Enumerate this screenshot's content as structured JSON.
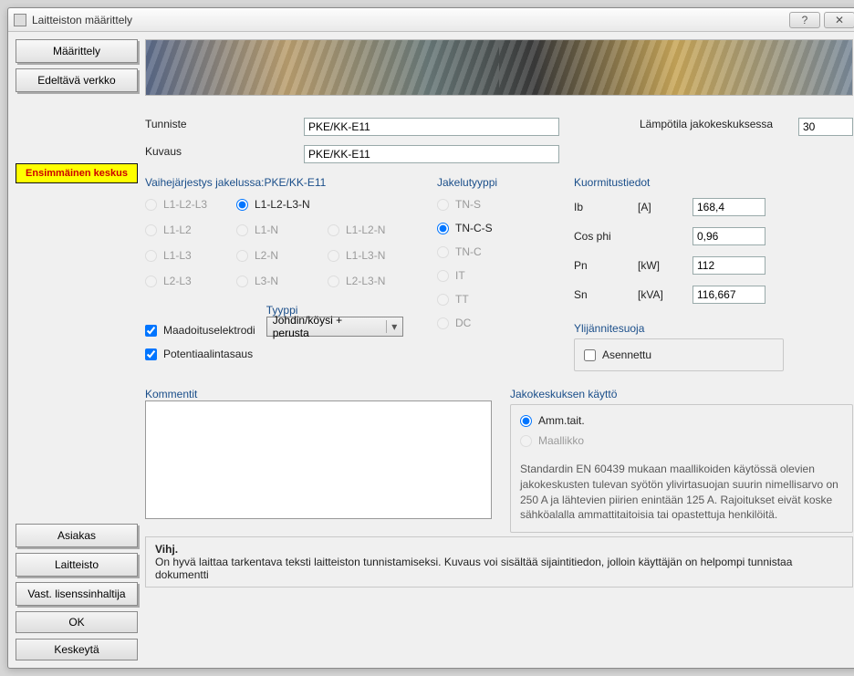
{
  "window": {
    "title": "Laitteiston määrittely"
  },
  "sidebar": {
    "define": "Määrittely",
    "prev_network": "Edeltävä verkko",
    "first_center": "Ensimmäinen keskus",
    "customer": "Asiakas",
    "hardware": "Laitteisto",
    "license_holder": "Vast. lisenssinhaltija",
    "ok": "OK",
    "cancel": "Keskeytä"
  },
  "labels": {
    "identifier": "Tunniste",
    "description": "Kuvaus",
    "phase_order_prefix": "Vaihejärjestys jakelussa:",
    "distribution_type": "Jakelutyyppi",
    "temp_in_dc": "Lämpötila jakokeskuksessa",
    "load_data": "Kuormitustiedot",
    "overvoltage": "Ylijännitesuoja",
    "type": "Tyyppi",
    "comments": "Kommentit",
    "usage": "Jakokeskuksen käyttö"
  },
  "values": {
    "identifier": "PKE/KK-E11",
    "description": "PKE/KK-E11",
    "phase_order_suffix": "PKE/KK-E11",
    "temp": "30",
    "ib": "168,4",
    "cosphi": "0,96",
    "pn": "112",
    "sn": "116,667",
    "combo": "Johdin/köysi + perusta"
  },
  "phase_options": {
    "r1": "L1-L2-L3",
    "r2": "L1-L2-L3-N",
    "r3": "L1-L2",
    "r4": "L1-N",
    "r5": "L1-L2-N",
    "r6": "L1-L3",
    "r7": "L2-N",
    "r8": "L1-L3-N",
    "r9": "L2-L3",
    "r10": "L3-N",
    "r11": "L2-L3-N"
  },
  "dist_options": {
    "tns": "TN-S",
    "tncs": "TN-C-S",
    "tnc": "TN-C",
    "it": "IT",
    "tt": "TT",
    "dc": "DC"
  },
  "load_labels": {
    "ib": "Ib",
    "ib_u": "[A]",
    "cos": "Cos phi",
    "pn": "Pn",
    "pn_u": "[kW]",
    "sn": "Sn",
    "sn_u": "[kVA]"
  },
  "checks": {
    "ground_electrode": "Maadoituselektrodi",
    "potential_eq": "Potentiaalintasaus",
    "installed": "Asennettu"
  },
  "usage_options": {
    "pro": "Amm.tait.",
    "lay": "Maallikko"
  },
  "info_text": "Standardin EN 60439 mukaan maallikoiden käytössä olevien jakokeskusten tulevan syötön ylivirtasuojan suurin nimellisarvo on 250 A ja lähtevien piirien enintään 125 A. Rajoitukset eivät koske sähköalalla ammattitaitoisia tai opastettuja henkilöitä.",
  "hint": {
    "title": "Vihj.",
    "body": "On hyvä laittaa tarkentava teksti laitteiston tunnistamiseksi. Kuvaus voi sisältää sijaintitiedon, jolloin käyttäjän on helpompi tunnistaa dokumentti"
  }
}
